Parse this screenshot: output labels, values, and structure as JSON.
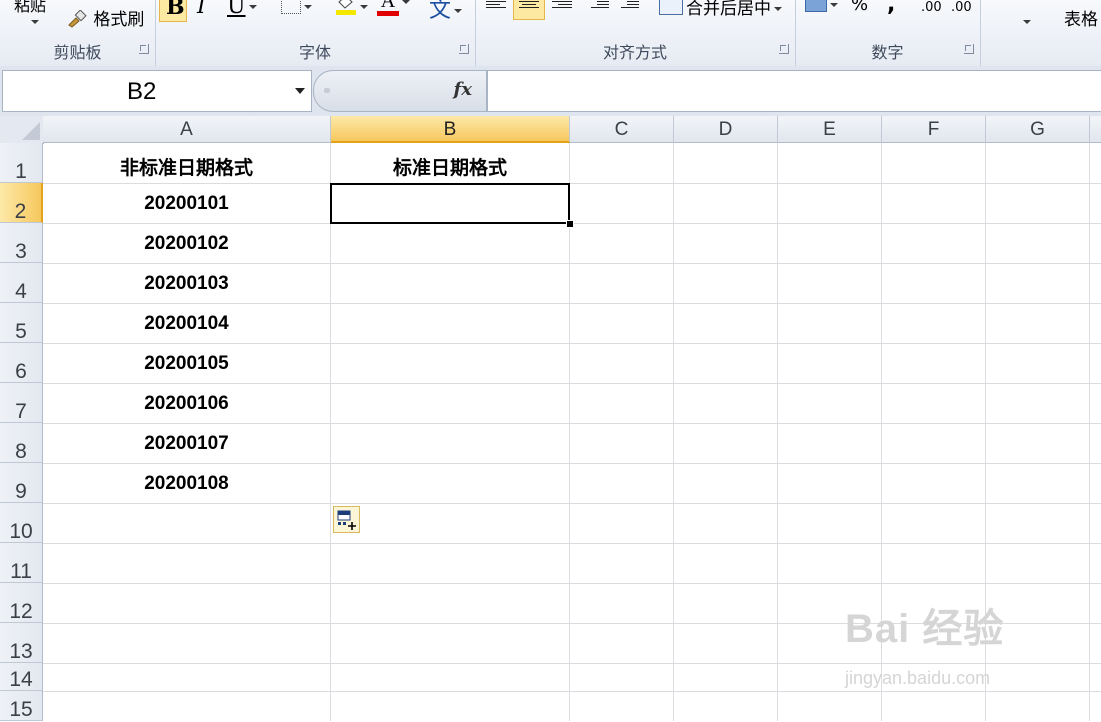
{
  "ribbon": {
    "clipboard": {
      "label": "剪贴板",
      "paste_label": "粘贴",
      "format_painter_label": "格式刷"
    },
    "font": {
      "label": "字体",
      "bold": "B",
      "italic": "I",
      "underline": "U",
      "font_color_glyph": "A",
      "phonetic_glyph": "文",
      "fill_color": "#f5e800",
      "font_color": "#e00000"
    },
    "alignment": {
      "label": "对齐方式",
      "merge_center_label": "合并后居中"
    },
    "number": {
      "label": "数字",
      "percent": "%",
      "comma": ",",
      "increase_decimal": ".00",
      "decrease_decimal": ".00"
    },
    "styles": {
      "table_format_label": "表格"
    }
  },
  "formula_bar": {
    "name_box_value": "B2",
    "fx_label": "fx",
    "formula_value": ""
  },
  "sheet": {
    "columns": [
      "A",
      "B",
      "C",
      "D",
      "E",
      "F",
      "G"
    ],
    "active_column": "B",
    "rows": [
      "1",
      "2",
      "3",
      "4",
      "5",
      "6",
      "7",
      "8",
      "9",
      "10",
      "11",
      "12",
      "13",
      "14",
      "15"
    ],
    "active_row": "2",
    "cells": {
      "A1": "非标准日期格式",
      "B1": "标准日期格式",
      "A2": "20200101",
      "A3": "20200102",
      "A4": "20200103",
      "A5": "20200104",
      "A6": "20200105",
      "A7": "20200106",
      "A8": "20200107",
      "A9": "20200108"
    },
    "selected_cell": "B2"
  },
  "watermark": {
    "brand": "Bai 经验",
    "sub": "jingyan.baidu.com"
  }
}
